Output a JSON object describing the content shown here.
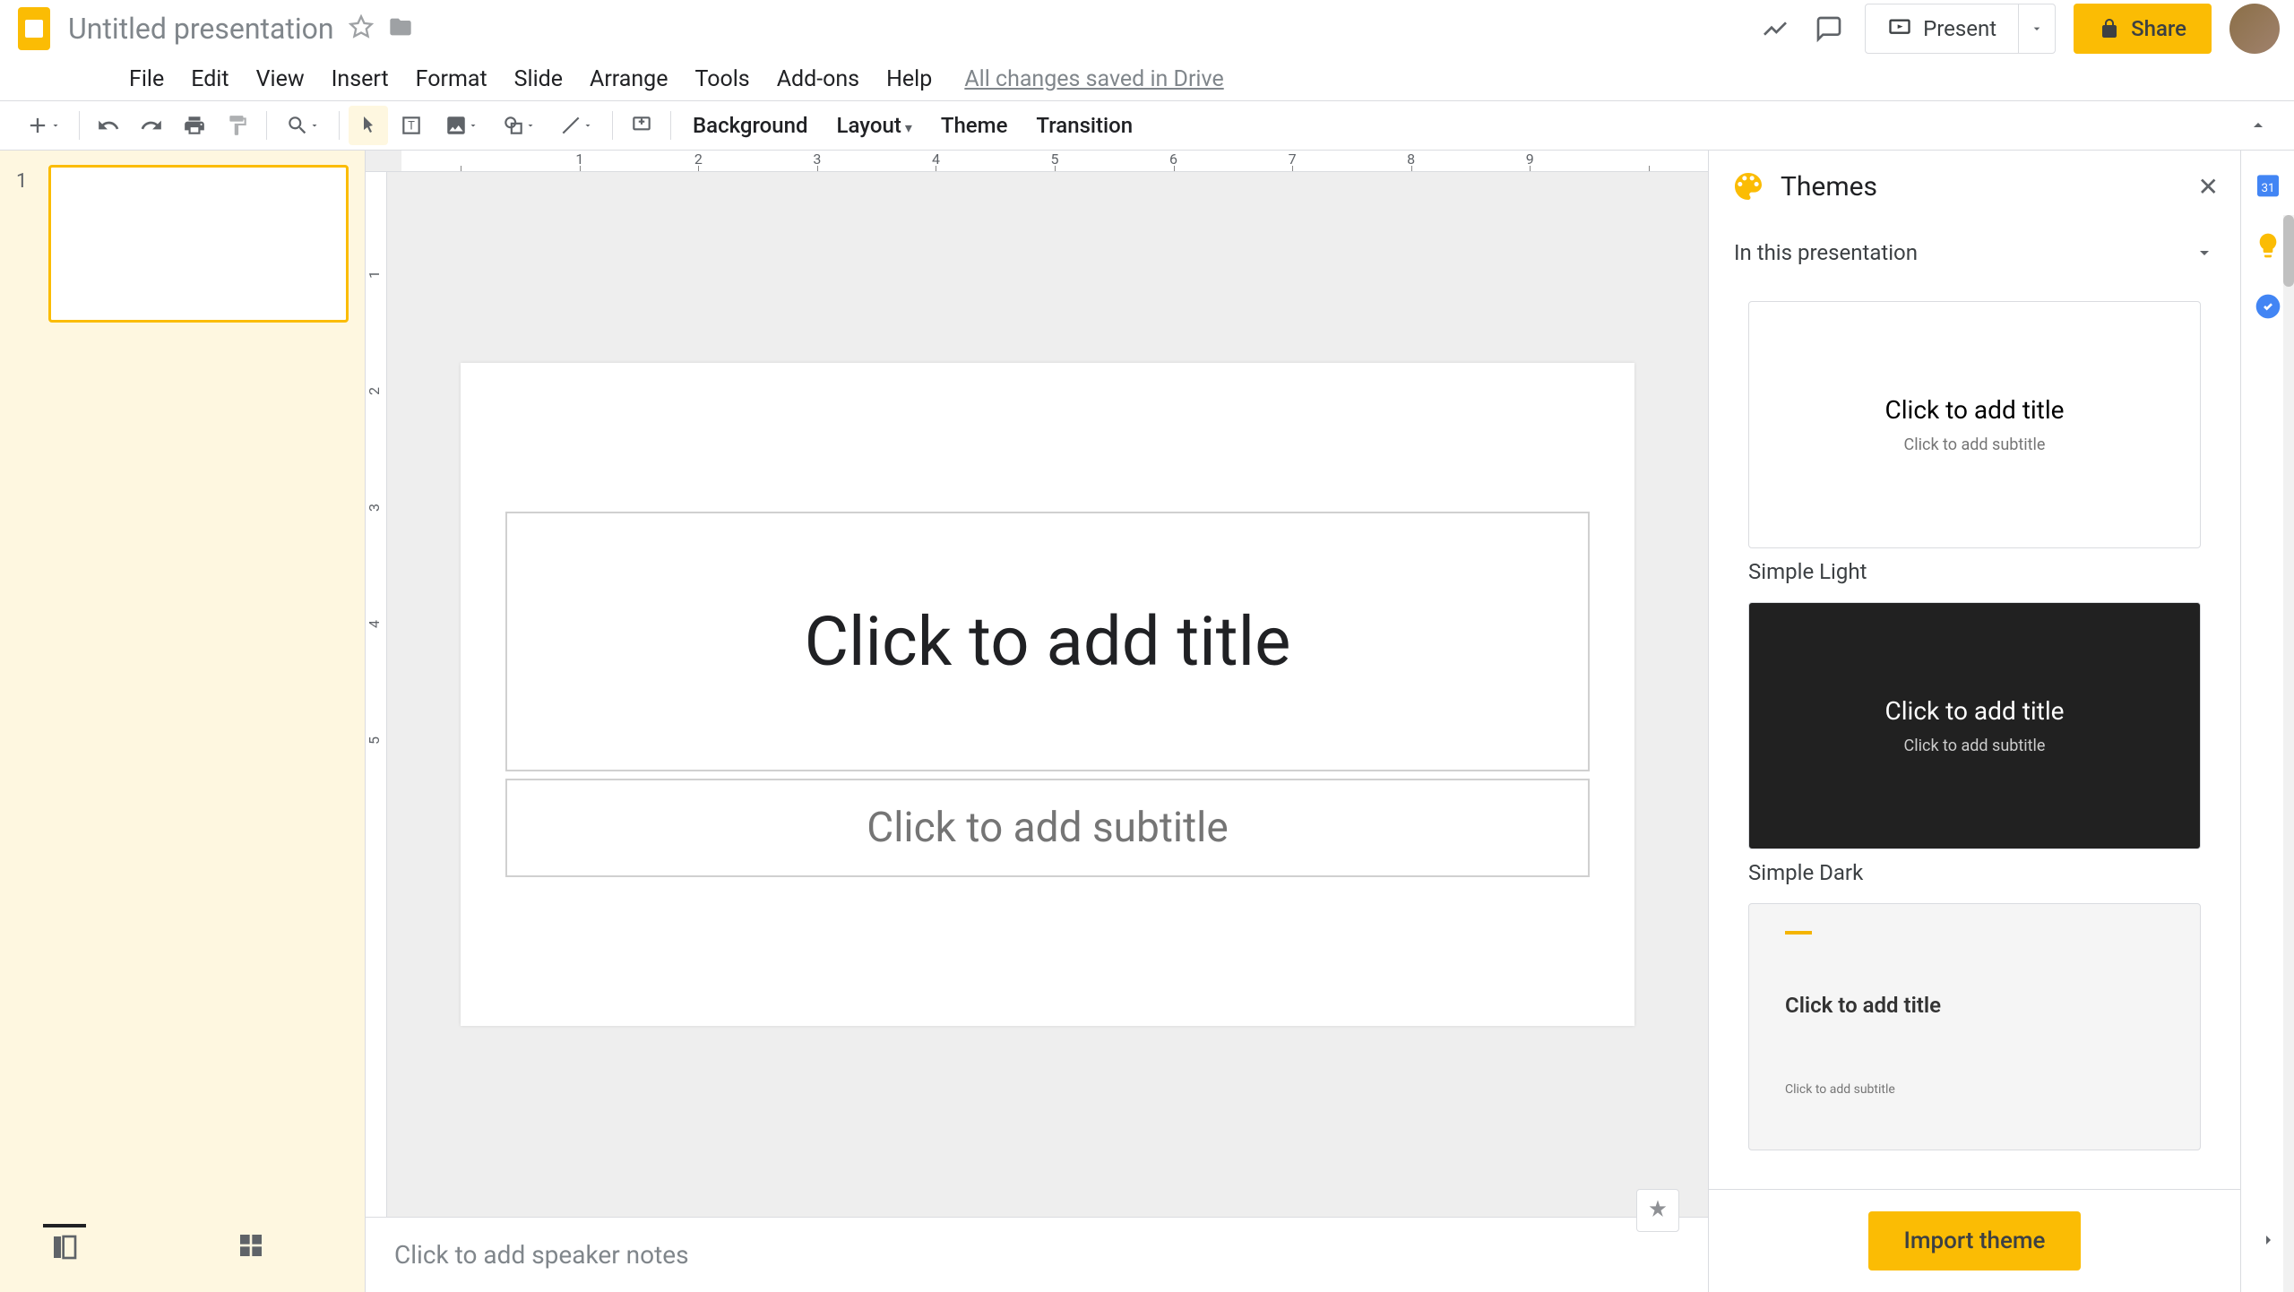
{
  "header": {
    "doc_title": "Untitled presentation",
    "present_label": "Present",
    "share_label": "Share",
    "drive_status": "All changes saved in Drive"
  },
  "menu": {
    "items": [
      "File",
      "Edit",
      "View",
      "Insert",
      "Format",
      "Slide",
      "Arrange",
      "Tools",
      "Add-ons",
      "Help"
    ]
  },
  "toolbar": {
    "background_label": "Background",
    "layout_label": "Layout",
    "theme_label": "Theme",
    "transition_label": "Transition"
  },
  "ruler_h": [
    "1",
    "2",
    "3",
    "4",
    "5",
    "6",
    "7",
    "8",
    "9"
  ],
  "ruler_v": [
    "1",
    "2",
    "3",
    "4",
    "5"
  ],
  "filmstrip": {
    "slides": [
      {
        "number": "1"
      }
    ]
  },
  "slide": {
    "title_placeholder": "Click to add title",
    "subtitle_placeholder": "Click to add subtitle"
  },
  "speaker_notes": {
    "placeholder": "Click to add speaker notes"
  },
  "themes_panel": {
    "title": "Themes",
    "section_label": "In this presentation",
    "themes": [
      {
        "name": "Simple Light",
        "preview_title": "Click to add title",
        "preview_sub": "Click to add subtitle",
        "variant": "light"
      },
      {
        "name": "Simple Dark",
        "preview_title": "Click to add title",
        "preview_sub": "Click to add subtitle",
        "variant": "dark"
      },
      {
        "name": "",
        "preview_title": "Click to add title",
        "preview_sub": "Click to add subtitle",
        "variant": "streamline"
      }
    ],
    "import_label": "Import theme"
  }
}
